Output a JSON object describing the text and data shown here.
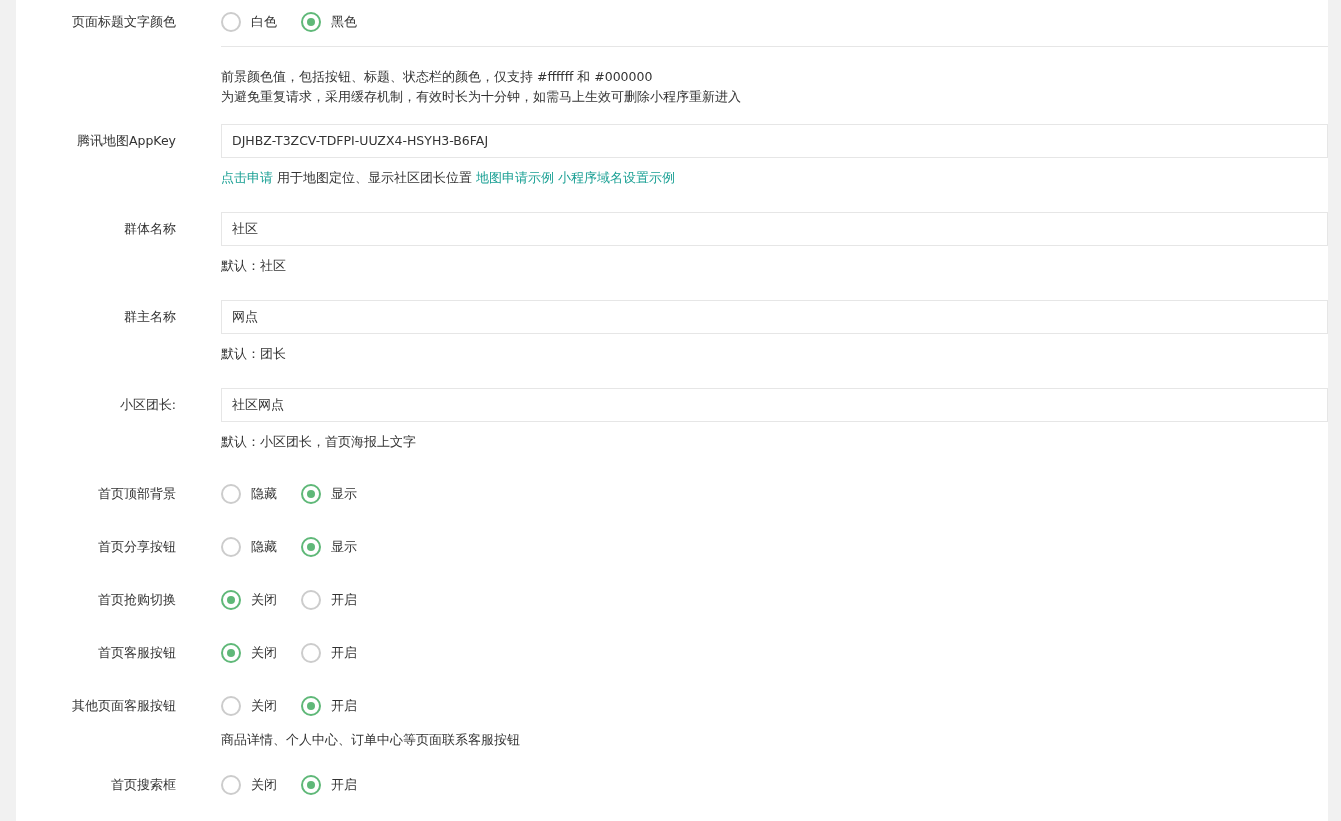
{
  "rows": [
    {
      "kind": "radio",
      "label": "页面标题文字颜色",
      "divider": true,
      "options": [
        {
          "label": "白色",
          "selected": false
        },
        {
          "label": "黑色",
          "selected": true
        }
      ],
      "help": [
        [
          {
            "text": "前景颜色值，包括按钮、标题、状态栏的颜色，仅支持 #ffffff 和 #000000",
            "link": false
          }
        ],
        [
          {
            "text": "为避免重复请求，采用缓存机制，有效时长为十分钟，如需马上生效可删除小程序重新进入",
            "link": false
          }
        ]
      ]
    },
    {
      "kind": "input",
      "label": "腾讯地图AppKey",
      "value": "DJHBZ-T3ZCV-TDFPI-UUZX4-HSYH3-B6FAJ",
      "help": [
        [
          {
            "text": "点击申请",
            "link": true
          },
          {
            "text": "用于地图定位、显示社区团长位置",
            "link": false
          },
          {
            "text": "地图申请示例",
            "link": true
          },
          {
            "text": "小程序域名设置示例",
            "link": true
          }
        ]
      ]
    },
    {
      "kind": "input",
      "label": "群体名称",
      "value": "社区",
      "help": [
        [
          {
            "text": "默认：社区",
            "link": false
          }
        ]
      ]
    },
    {
      "kind": "input",
      "label": "群主名称",
      "value": "网点",
      "help": [
        [
          {
            "text": "默认：团长",
            "link": false
          }
        ]
      ]
    },
    {
      "kind": "input",
      "label": "小区团长:",
      "value": "社区网点",
      "help": [
        [
          {
            "text": "默认：小区团长，首页海报上文字",
            "link": false
          }
        ]
      ]
    },
    {
      "kind": "radio",
      "label": "首页顶部背景",
      "options": [
        {
          "label": "隐藏",
          "selected": false
        },
        {
          "label": "显示",
          "selected": true
        }
      ]
    },
    {
      "kind": "radio",
      "label": "首页分享按钮",
      "options": [
        {
          "label": "隐藏",
          "selected": false
        },
        {
          "label": "显示",
          "selected": true
        }
      ]
    },
    {
      "kind": "radio",
      "label": "首页抢购切换",
      "options": [
        {
          "label": "关闭",
          "selected": true
        },
        {
          "label": "开启",
          "selected": false
        }
      ]
    },
    {
      "kind": "radio",
      "label": "首页客服按钮",
      "options": [
        {
          "label": "关闭",
          "selected": true
        },
        {
          "label": "开启",
          "selected": false
        }
      ]
    },
    {
      "kind": "radio",
      "label": "其他页面客服按钮",
      "options": [
        {
          "label": "关闭",
          "selected": false
        },
        {
          "label": "开启",
          "selected": true
        }
      ],
      "help": [
        [
          {
            "text": "商品详情、个人中心、订单中心等页面联系客服按钮",
            "link": false
          }
        ]
      ]
    },
    {
      "kind": "radio",
      "label": "首页搜索框",
      "options": [
        {
          "label": "关闭",
          "selected": false
        },
        {
          "label": "开启",
          "selected": true
        }
      ]
    }
  ]
}
